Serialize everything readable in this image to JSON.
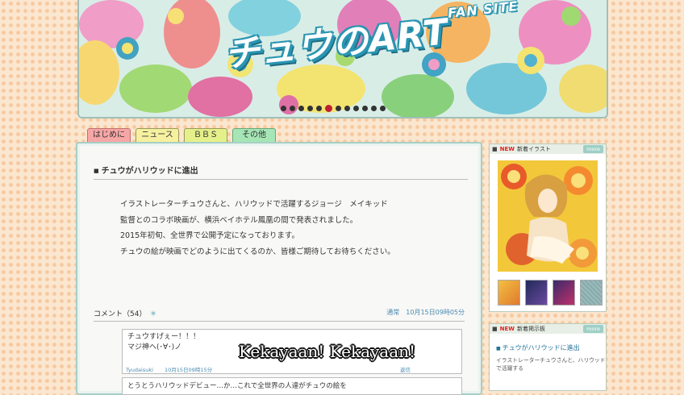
{
  "banner": {
    "logo_main": "チュウのART",
    "logo_sub": "FAN SITE",
    "slide_count": 12,
    "active_slide": 5
  },
  "tabs": [
    {
      "label": "はじめに"
    },
    {
      "label": "ニュース"
    },
    {
      "label": "ＢＢＳ"
    },
    {
      "label": "その他"
    }
  ],
  "article": {
    "title": "チュウがハリウッドに進出",
    "lines": [
      "イラストレーターチュウさんと、ハリウッドで活躍するジョージ　メイキッド",
      "監督とのコラボ映画が、横浜ベイホテル鳳凰の間で発表されました。",
      "2015年初旬、全世界で公開予定になっております。",
      "チュウの絵が映画でどのように出てくるのか、皆様ご期待してお待ちください。"
    ]
  },
  "comments": {
    "header": "コメント（54）",
    "star": "＊",
    "right_text": "通常　10月15日09時05分",
    "first": {
      "line1": "チュウすげぇー！！！",
      "line2": "マジ神ヘ(･∀･)ノ",
      "author": "Tyudaisuki",
      "date": "10月15日09時15分",
      "right": "返信"
    },
    "second_preview": "とうとうハリウッドデビュー…か…これで全世界の人達がチュウの絵を"
  },
  "sidebar": {
    "new_label": "NEW",
    "illust_title": "新着イラスト",
    "more_label": "more",
    "bbs_title": "新着掲示板",
    "bbs_post_title": "チュウがハリウッドに進出",
    "bbs_post_body1": "イラストレーターチュウさんと、ハリウッド",
    "bbs_post_body2": "で活躍する"
  },
  "subtitle": "Kekayaan! Kekayaan!",
  "colors": {
    "accent": "#2a95b2",
    "new_red": "#dd2222",
    "panel_border": "#a6cfc6"
  }
}
